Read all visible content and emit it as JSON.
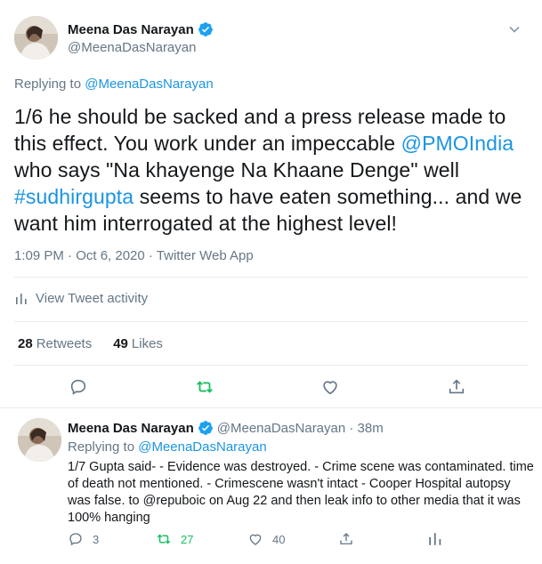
{
  "main_tweet": {
    "author_name": "Meena Das Narayan",
    "author_handle": "@MeenaDasNarayan",
    "replying_prefix": "Replying to",
    "replying_to": "@MeenaDasNarayan",
    "text_parts": {
      "p1": "1/6 he should be sacked and a press release made to this effect. You work under an impeccable ",
      "mention": "@PMOIndia",
      "p2": " who says \"Na khayenge Na Khaane Denge\" well ",
      "hashtag": "#sudhirgupta",
      "p3": " seems to have eaten something... and we want him interrogated at the highest level!"
    },
    "timestamp": "1:09 PM · Oct 6, 2020 · Twitter Web App",
    "activity_label": "View Tweet activity",
    "retweets_count": "28",
    "retweets_label": "Retweets",
    "likes_count": "49",
    "likes_label": "Likes"
  },
  "reply_tweet": {
    "author_name": "Meena Das Narayan",
    "handle_time": "@MeenaDasNarayan · 38m",
    "replying_prefix": "Replying to",
    "replying_to": "@MeenaDasNarayan",
    "text": "1/7 Gupta said- - Evidence was destroyed. - Crime scene was contaminated. time of death not mentioned. - Crimescene wasn't intact - Cooper Hospital autopsy was false. to @repuboic on Aug 22 and then leak info to other media that it was 100% hanging",
    "reply_count": "3",
    "retweet_count": "27",
    "like_count": "40"
  },
  "colors": {
    "link": "#1b95e0",
    "secondary_text": "#657786",
    "retweet_green": "#17bf63",
    "verified": "#1da1f2"
  },
  "icons": [
    "verified-badge-icon",
    "chevron-down-icon",
    "bar-chart-icon",
    "reply-icon",
    "retweet-icon",
    "like-icon",
    "share-icon"
  ]
}
